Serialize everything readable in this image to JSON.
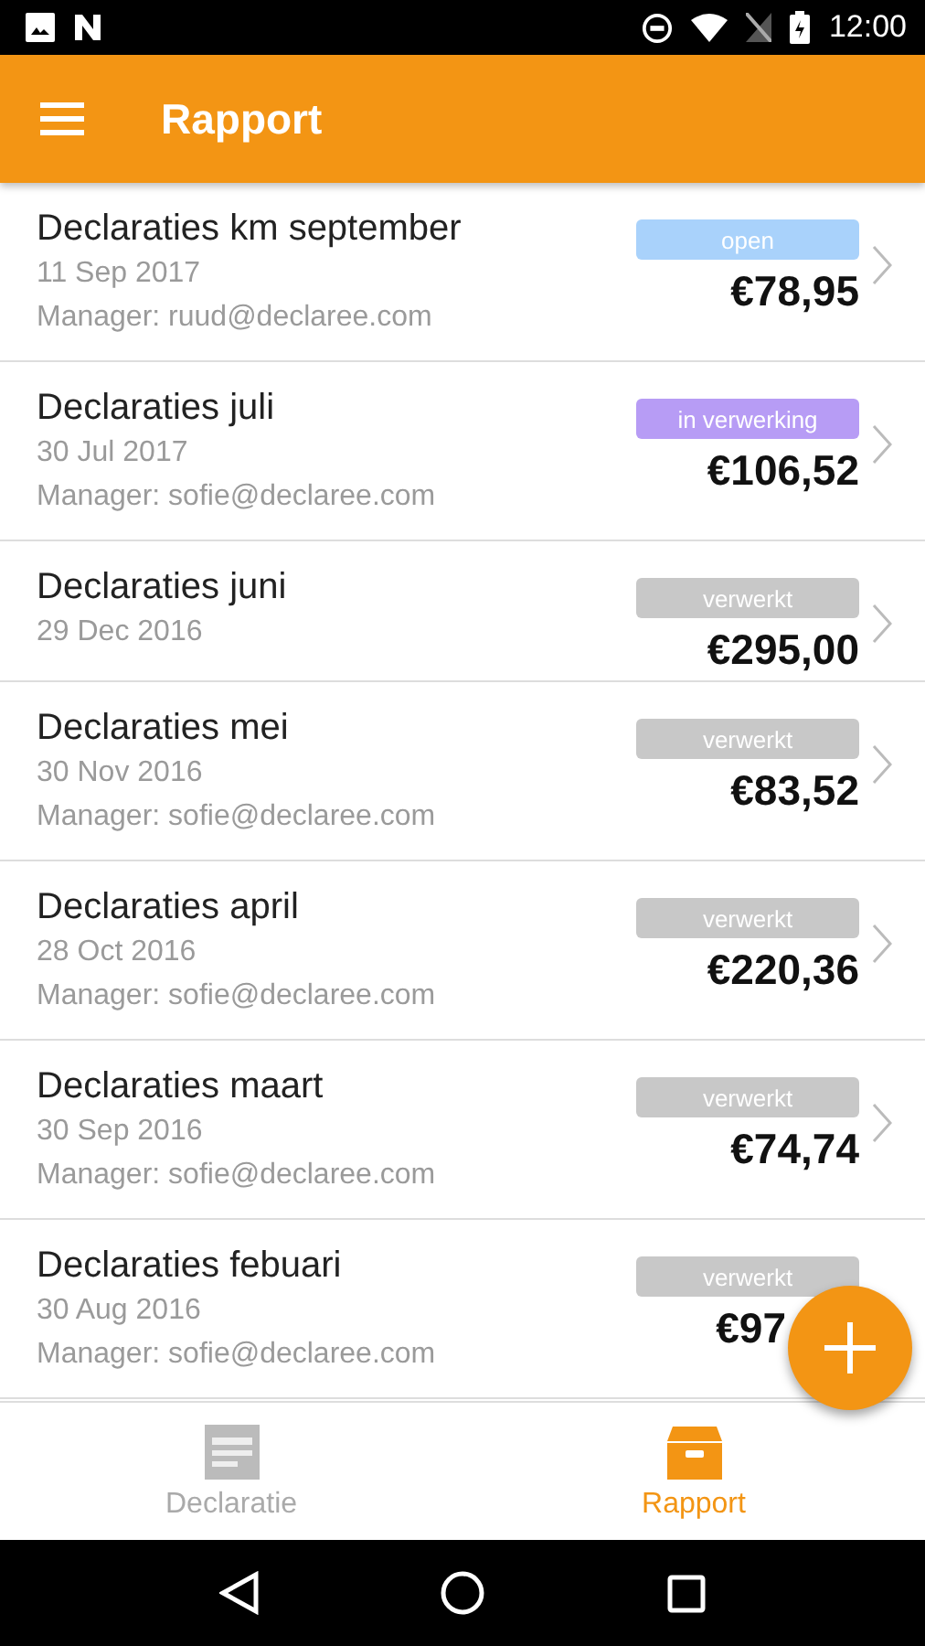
{
  "status_bar": {
    "time": "12:00"
  },
  "app_bar": {
    "title": "Rapport"
  },
  "reports": [
    {
      "title": "Declaraties km september",
      "date": "11 Sep 2017",
      "manager": "Manager: ruud@declaree.com",
      "status": "open",
      "color": "#a9d2fb",
      "amount": "€78,95",
      "chevron": true
    },
    {
      "title": "Declaraties juli",
      "date": "30 Jul 2017",
      "manager": "Manager: sofie@declaree.com",
      "status": "in verwerking",
      "color": "#b79cf5",
      "amount": "€106,52",
      "chevron": true
    },
    {
      "title": "Declaraties juni",
      "date": "29 Dec 2016",
      "status": "verwerkt",
      "color": "#c8c8c8",
      "amount": "€295,00",
      "chevron": true
    },
    {
      "title": "Declaraties mei",
      "date": "30 Nov 2016",
      "manager": "Manager: sofie@declaree.com",
      "status": "verwerkt",
      "color": "#c8c8c8",
      "amount": "€83,52",
      "chevron": true
    },
    {
      "title": "Declaraties april",
      "date": "28 Oct 2016",
      "manager": "Manager: sofie@declaree.com",
      "status": "verwerkt",
      "color": "#c8c8c8",
      "amount": "€220,36",
      "chevron": true
    },
    {
      "title": "Declaraties maart",
      "date": "30 Sep 2016",
      "manager": "Manager: sofie@declaree.com",
      "status": "verwerkt",
      "color": "#c8c8c8",
      "amount": "€74,74",
      "chevron": true
    },
    {
      "title": "Declaraties febuari",
      "date": "30 Aug 2016",
      "manager": "Manager: sofie@declaree.com",
      "status": "verwerkt",
      "color": "#c8c8c8",
      "amount": "€97",
      "chevron": false
    }
  ],
  "bottom_tabs": [
    {
      "label": "Declaratie",
      "kind": "receipt",
      "selected": false
    },
    {
      "label": "Rapport",
      "kind": "box",
      "selected": true
    }
  ]
}
